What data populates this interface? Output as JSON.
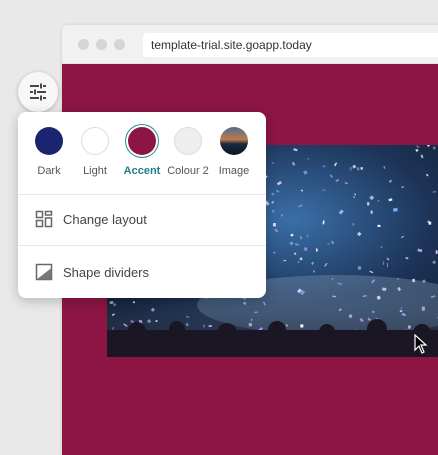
{
  "browser": {
    "url": "template-trial.site.goapp.today"
  },
  "settings_button": {
    "icon": "sliders-icon"
  },
  "colors": {
    "page_background": "#8c1543",
    "accent_label": "#1f7f86"
  },
  "swatches": [
    {
      "label": "Dark",
      "color": "#1b2470",
      "selected": false
    },
    {
      "label": "Light",
      "color": "#ffffff",
      "selected": false
    },
    {
      "label": "Accent",
      "color": "#8c1543",
      "selected": true
    },
    {
      "label": "Colour 2",
      "color": "#eeeeee",
      "selected": false
    },
    {
      "label": "Image",
      "color": "image",
      "selected": false
    }
  ],
  "menu_items": [
    {
      "label": "Change layout",
      "icon": "layout-icon"
    },
    {
      "label": "Shape dividers",
      "icon": "shape-divider-icon"
    }
  ]
}
